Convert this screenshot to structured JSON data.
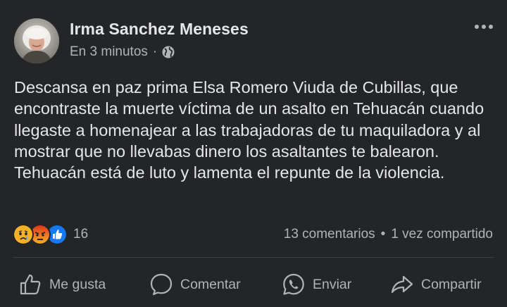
{
  "post": {
    "author": "Irma Sanchez Meneses",
    "time": "En 3 minutos",
    "separator": "·",
    "privacy_icon": "globe-icon",
    "more_icon": "more-options-icon",
    "body": "Descansa en paz prima Elsa Romero Viuda de Cubillas, que encontraste la muerte víctima de un asalto en Tehuacán cuando llegaste a homenajear a las trabajadoras de tu maquiladora y al mostrar que no llevabas dinero los asaltantes te balearon.\nTehuacán está de luto y lamenta el repunte de la violencia."
  },
  "reactions": {
    "icons": [
      "sad-reaction-icon",
      "angry-reaction-icon",
      "like-reaction-icon"
    ],
    "count": "16"
  },
  "stats": {
    "comments": "13 comentarios",
    "separator": "•",
    "shares": "1 vez compartido"
  },
  "actions": {
    "like_label": "Me gusta",
    "comment_label": "Comentar",
    "send_label": "Enviar",
    "share_label": "Compartir"
  },
  "colors": {
    "background": "#242526",
    "text_primary": "#e4e6eb",
    "text_secondary": "#b0b3b8",
    "divider": "#3e4042",
    "like_blue": "#1877f2",
    "reaction_yellow": "#f7b125",
    "angry_red": "#e9710f"
  }
}
